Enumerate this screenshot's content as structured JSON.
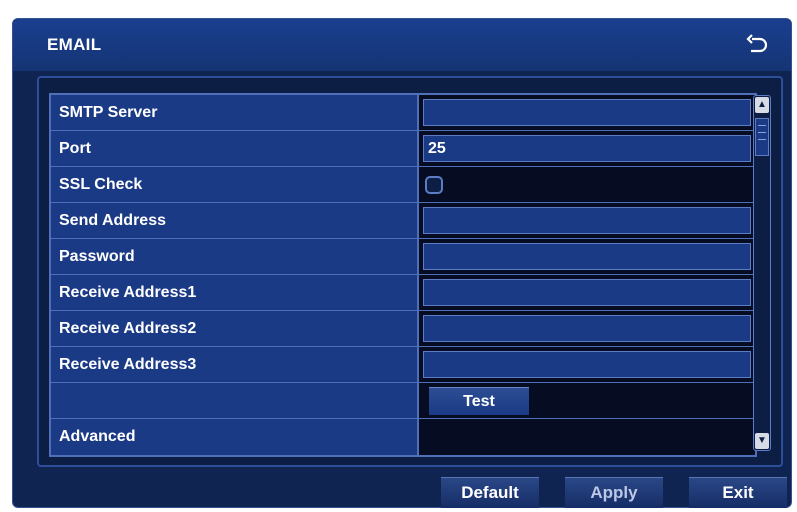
{
  "window": {
    "title": "EMAIL"
  },
  "rows": [
    {
      "label": "SMTP Server",
      "value": ""
    },
    {
      "label": "Port",
      "value": "25"
    },
    {
      "label": "SSL Check",
      "checked": false
    },
    {
      "label": "Send Address",
      "value": ""
    },
    {
      "label": "Password",
      "value": ""
    },
    {
      "label": "Receive Address1",
      "value": ""
    },
    {
      "label": "Receive Address2",
      "value": ""
    },
    {
      "label": "Receive Address3",
      "value": ""
    },
    {
      "label": "",
      "button": "Test"
    },
    {
      "label": "Advanced"
    }
  ],
  "footer": {
    "default_label": "Default",
    "apply_label": "Apply",
    "exit_label": "Exit"
  },
  "icons": {
    "back": "back-arrow-icon",
    "scroll_up": "triangle-up-icon",
    "scroll_down": "triangle-down-icon"
  },
  "colors": {
    "window_bg": "#0f2450",
    "label_bg": "#1b3a86",
    "value_bg": "#060d22",
    "border": "#4f6fb8",
    "text": "#ffffff"
  }
}
